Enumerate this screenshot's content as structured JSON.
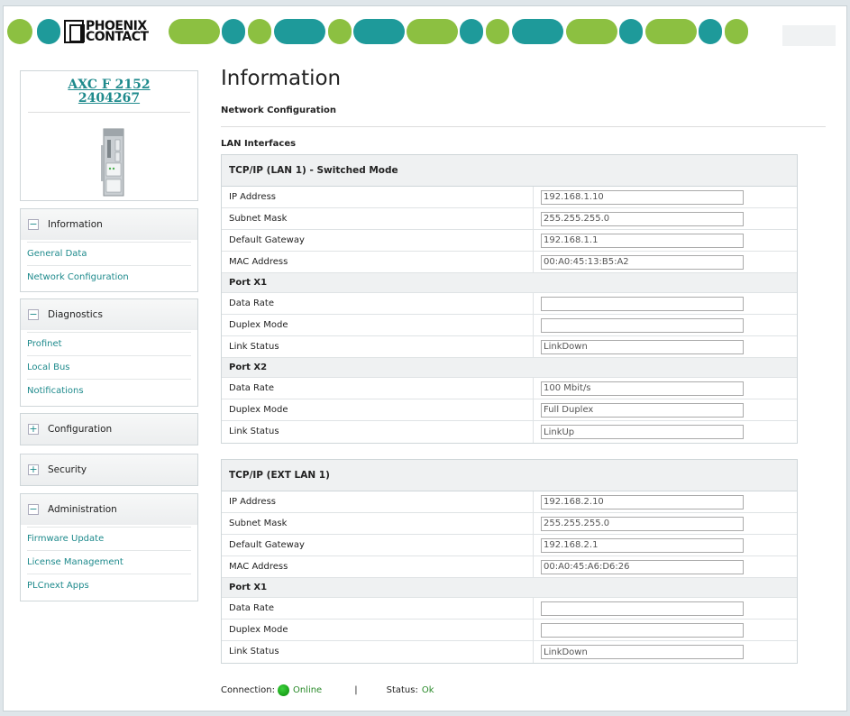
{
  "header": {
    "logo_text_1": "PHOENIX",
    "logo_text_2": "CONTACT",
    "colors": {
      "green": "#8cc041",
      "teal": "#1e9a9a"
    }
  },
  "device": {
    "model": "AXC F 2152",
    "article_no": "2404267"
  },
  "sidebar": {
    "groups": [
      {
        "label": "Information",
        "expanded": true,
        "toggle": "−",
        "items": [
          "General Data",
          "Network Configuration"
        ]
      },
      {
        "label": "Diagnostics",
        "expanded": true,
        "toggle": "−",
        "items": [
          "Profinet",
          "Local Bus",
          "Notifications"
        ]
      },
      {
        "label": "Configuration",
        "expanded": false,
        "toggle": "+",
        "items": []
      },
      {
        "label": "Security",
        "expanded": false,
        "toggle": "+",
        "items": []
      },
      {
        "label": "Administration",
        "expanded": true,
        "toggle": "−",
        "items": [
          "Firmware Update",
          "License Management",
          "PLCnext Apps"
        ]
      }
    ]
  },
  "main": {
    "title": "Information",
    "section": "Network Configuration",
    "lan_title": "LAN Interfaces",
    "interfaces": [
      {
        "title": "TCP/IP (LAN 1) - Switched Mode",
        "rows": [
          {
            "label": "IP Address",
            "value": "192.168.1.10"
          },
          {
            "label": "Subnet Mask",
            "value": "255.255.255.0"
          },
          {
            "label": "Default Gateway",
            "value": "192.168.1.1"
          },
          {
            "label": "MAC Address",
            "value": "00:A0:45:13:B5:A2"
          }
        ],
        "ports": [
          {
            "title": "Port X1",
            "rows": [
              {
                "label": "Data Rate",
                "value": ""
              },
              {
                "label": "Duplex Mode",
                "value": ""
              },
              {
                "label": "Link Status",
                "value": "LinkDown"
              }
            ]
          },
          {
            "title": "Port X2",
            "rows": [
              {
                "label": "Data Rate",
                "value": "100 Mbit/s"
              },
              {
                "label": "Duplex Mode",
                "value": "Full Duplex"
              },
              {
                "label": "Link Status",
                "value": "LinkUp"
              }
            ]
          }
        ]
      },
      {
        "title": "TCP/IP (EXT LAN 1)",
        "rows": [
          {
            "label": "IP Address",
            "value": "192.168.2.10"
          },
          {
            "label": "Subnet Mask",
            "value": "255.255.255.0"
          },
          {
            "label": "Default Gateway",
            "value": "192.168.2.1"
          },
          {
            "label": "MAC Address",
            "value": "00:A0:45:A6:D6:26"
          }
        ],
        "ports": [
          {
            "title": "Port X1",
            "rows": [
              {
                "label": "Data Rate",
                "value": ""
              },
              {
                "label": "Duplex Mode",
                "value": ""
              },
              {
                "label": "Link Status",
                "value": "LinkDown"
              }
            ]
          }
        ]
      }
    ]
  },
  "footer": {
    "connection_label": "Connection:",
    "connection_value": "Online",
    "separator": "|",
    "status_label": "Status:",
    "status_value": "Ok"
  }
}
